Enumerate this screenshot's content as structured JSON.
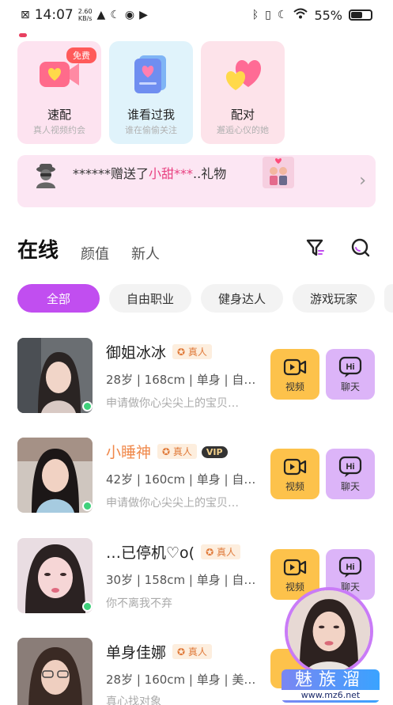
{
  "status_bar": {
    "time": "14:07",
    "speed_value": "2.60",
    "speed_unit": "KB/s",
    "battery_percent": "55%",
    "battery_level": 0.55
  },
  "cards": [
    {
      "title": "速配",
      "subtitle": "真人视频约会",
      "badge": "免费",
      "bg": "#fde3f0"
    },
    {
      "title": "谁看过我",
      "subtitle": "谁在偷偷关注",
      "bg": "#e0f3fb"
    },
    {
      "title": "配对",
      "subtitle": "邂逅心仪的她",
      "bg": "#fde3ea"
    }
  ],
  "gift_banner": {
    "prefix": "******赠送了",
    "recipient": "小甜***",
    "suffix": "..礼物"
  },
  "tabs": [
    "在线",
    "颜值",
    "新人"
  ],
  "chips": [
    "全部",
    "自由职业",
    "健身达人",
    "游戏玩家"
  ],
  "video_label": "视频",
  "chat_label": "聊天",
  "real_badge": "真人",
  "vip_badge": "VIP",
  "users": [
    {
      "name": "御姐冰冰",
      "info": "28岁 | 168cm | 单身 | 自…",
      "bio": "申请做你心尖尖上的宝贝…"
    },
    {
      "name": "小睡神",
      "info": "42岁 | 160cm | 单身 | 自…",
      "bio": "申请做你心尖尖上的宝贝…"
    },
    {
      "name": "…已停机♡o(",
      "info": "30岁 | 158cm | 单身 | 自…",
      "bio": "你不离我不弃"
    },
    {
      "name": "单身佳娜",
      "info": "28岁 | 160cm | 单身 | 美…",
      "bio": "真心找对象"
    }
  ],
  "watermark": {
    "brand": "魅族溜",
    "url": "www.mz6.net"
  },
  "colors": {
    "accent": "#c14ef0",
    "video_button": "#fdc24b",
    "chat_button": "#dcb4f8",
    "online": "#3fd17b"
  }
}
